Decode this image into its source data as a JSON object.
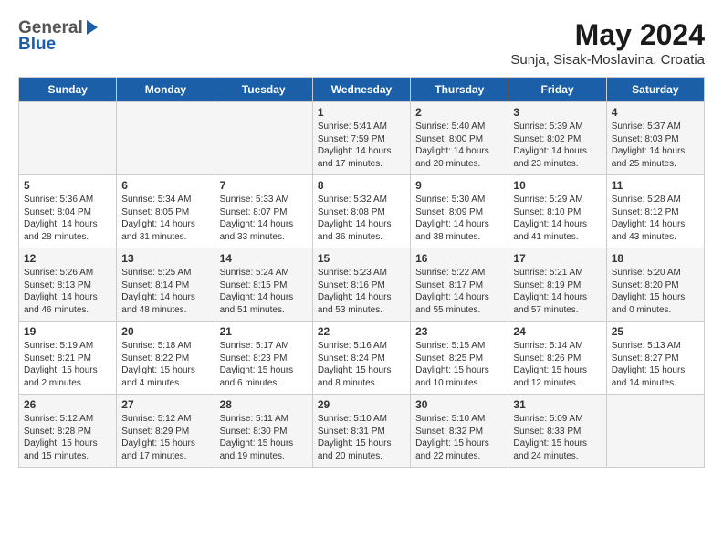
{
  "header": {
    "logo_general": "General",
    "logo_blue": "Blue",
    "month_year": "May 2024",
    "location": "Sunja, Sisak-Moslavina, Croatia"
  },
  "weekdays": [
    "Sunday",
    "Monday",
    "Tuesday",
    "Wednesday",
    "Thursday",
    "Friday",
    "Saturday"
  ],
  "weeks": [
    [
      {
        "day": "",
        "info": ""
      },
      {
        "day": "",
        "info": ""
      },
      {
        "day": "",
        "info": ""
      },
      {
        "day": "1",
        "info": "Sunrise: 5:41 AM\nSunset: 7:59 PM\nDaylight: 14 hours\nand 17 minutes."
      },
      {
        "day": "2",
        "info": "Sunrise: 5:40 AM\nSunset: 8:00 PM\nDaylight: 14 hours\nand 20 minutes."
      },
      {
        "day": "3",
        "info": "Sunrise: 5:39 AM\nSunset: 8:02 PM\nDaylight: 14 hours\nand 23 minutes."
      },
      {
        "day": "4",
        "info": "Sunrise: 5:37 AM\nSunset: 8:03 PM\nDaylight: 14 hours\nand 25 minutes."
      }
    ],
    [
      {
        "day": "5",
        "info": "Sunrise: 5:36 AM\nSunset: 8:04 PM\nDaylight: 14 hours\nand 28 minutes."
      },
      {
        "day": "6",
        "info": "Sunrise: 5:34 AM\nSunset: 8:05 PM\nDaylight: 14 hours\nand 31 minutes."
      },
      {
        "day": "7",
        "info": "Sunrise: 5:33 AM\nSunset: 8:07 PM\nDaylight: 14 hours\nand 33 minutes."
      },
      {
        "day": "8",
        "info": "Sunrise: 5:32 AM\nSunset: 8:08 PM\nDaylight: 14 hours\nand 36 minutes."
      },
      {
        "day": "9",
        "info": "Sunrise: 5:30 AM\nSunset: 8:09 PM\nDaylight: 14 hours\nand 38 minutes."
      },
      {
        "day": "10",
        "info": "Sunrise: 5:29 AM\nSunset: 8:10 PM\nDaylight: 14 hours\nand 41 minutes."
      },
      {
        "day": "11",
        "info": "Sunrise: 5:28 AM\nSunset: 8:12 PM\nDaylight: 14 hours\nand 43 minutes."
      }
    ],
    [
      {
        "day": "12",
        "info": "Sunrise: 5:26 AM\nSunset: 8:13 PM\nDaylight: 14 hours\nand 46 minutes."
      },
      {
        "day": "13",
        "info": "Sunrise: 5:25 AM\nSunset: 8:14 PM\nDaylight: 14 hours\nand 48 minutes."
      },
      {
        "day": "14",
        "info": "Sunrise: 5:24 AM\nSunset: 8:15 PM\nDaylight: 14 hours\nand 51 minutes."
      },
      {
        "day": "15",
        "info": "Sunrise: 5:23 AM\nSunset: 8:16 PM\nDaylight: 14 hours\nand 53 minutes."
      },
      {
        "day": "16",
        "info": "Sunrise: 5:22 AM\nSunset: 8:17 PM\nDaylight: 14 hours\nand 55 minutes."
      },
      {
        "day": "17",
        "info": "Sunrise: 5:21 AM\nSunset: 8:19 PM\nDaylight: 14 hours\nand 57 minutes."
      },
      {
        "day": "18",
        "info": "Sunrise: 5:20 AM\nSunset: 8:20 PM\nDaylight: 15 hours\nand 0 minutes."
      }
    ],
    [
      {
        "day": "19",
        "info": "Sunrise: 5:19 AM\nSunset: 8:21 PM\nDaylight: 15 hours\nand 2 minutes."
      },
      {
        "day": "20",
        "info": "Sunrise: 5:18 AM\nSunset: 8:22 PM\nDaylight: 15 hours\nand 4 minutes."
      },
      {
        "day": "21",
        "info": "Sunrise: 5:17 AM\nSunset: 8:23 PM\nDaylight: 15 hours\nand 6 minutes."
      },
      {
        "day": "22",
        "info": "Sunrise: 5:16 AM\nSunset: 8:24 PM\nDaylight: 15 hours\nand 8 minutes."
      },
      {
        "day": "23",
        "info": "Sunrise: 5:15 AM\nSunset: 8:25 PM\nDaylight: 15 hours\nand 10 minutes."
      },
      {
        "day": "24",
        "info": "Sunrise: 5:14 AM\nSunset: 8:26 PM\nDaylight: 15 hours\nand 12 minutes."
      },
      {
        "day": "25",
        "info": "Sunrise: 5:13 AM\nSunset: 8:27 PM\nDaylight: 15 hours\nand 14 minutes."
      }
    ],
    [
      {
        "day": "26",
        "info": "Sunrise: 5:12 AM\nSunset: 8:28 PM\nDaylight: 15 hours\nand 15 minutes."
      },
      {
        "day": "27",
        "info": "Sunrise: 5:12 AM\nSunset: 8:29 PM\nDaylight: 15 hours\nand 17 minutes."
      },
      {
        "day": "28",
        "info": "Sunrise: 5:11 AM\nSunset: 8:30 PM\nDaylight: 15 hours\nand 19 minutes."
      },
      {
        "day": "29",
        "info": "Sunrise: 5:10 AM\nSunset: 8:31 PM\nDaylight: 15 hours\nand 20 minutes."
      },
      {
        "day": "30",
        "info": "Sunrise: 5:10 AM\nSunset: 8:32 PM\nDaylight: 15 hours\nand 22 minutes."
      },
      {
        "day": "31",
        "info": "Sunrise: 5:09 AM\nSunset: 8:33 PM\nDaylight: 15 hours\nand 24 minutes."
      },
      {
        "day": "",
        "info": ""
      }
    ]
  ]
}
